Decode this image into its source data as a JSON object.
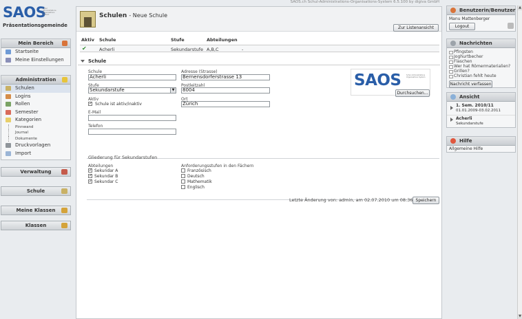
{
  "topbar": {
    "product_line": "SAOS.ch Schul-Administrations-Organisations-System 6.5.100 by digiva GmbH"
  },
  "logo": {
    "text": "SAOS",
    "small": "Schul Administrations Organisations System",
    "subtitle": "Präsentationsgemeinde"
  },
  "left": {
    "mein_bereich": {
      "title": "Mein Bereich",
      "items": [
        {
          "label": "Startseite",
          "icon": "home-icon"
        },
        {
          "label": "Meine Einstellungen",
          "icon": "settings-icon"
        }
      ]
    },
    "administration": {
      "title": "Administration",
      "items": [
        {
          "label": "Schulen",
          "icon": "school-icon"
        },
        {
          "label": "Logins",
          "icon": "users-icon"
        },
        {
          "label": "Rollen",
          "icon": "roles-icon"
        },
        {
          "label": "Semester",
          "icon": "calendar-icon"
        },
        {
          "label": "Kategorien",
          "icon": "folder-icon"
        }
      ],
      "subitems": [
        "Pinnwand",
        "Journal",
        "Dokumente"
      ],
      "items2": [
        {
          "label": "Druckvorlagen",
          "icon": "print-icon"
        },
        {
          "label": "Import",
          "icon": "import-icon"
        }
      ]
    },
    "collapsed": [
      "Verwaltung",
      "Schule",
      "Meine Klassen",
      "Klassen"
    ]
  },
  "main": {
    "title": "Schulen",
    "subtitle": "- Neue Schule",
    "list_button": "Zur Listenansicht",
    "columns": [
      "Aktiv",
      "Schule",
      "Stufe",
      "Abteilungen"
    ],
    "row": {
      "schule": "Acherli",
      "stufe": "Sekundarstufe",
      "abteilungen": "A,B,C",
      "extra": "-"
    },
    "section": "Schule",
    "form": {
      "schule_label": "Schule",
      "schule_value": "Acherli",
      "adresse_label": "Adresse (Strasse)",
      "adresse_value": "Bernensdorferstrasse 13",
      "stufe_label": "Stufe",
      "stufe_value": "Sekundarstufe",
      "plz_label": "Postleitzahl",
      "plz_value": "8004",
      "aktiv_label": "Aktiv",
      "aktiv_cb": "Schule ist aktiv/inaktiv",
      "ort_label": "Ort",
      "ort_value": "Zürich",
      "email_label": "E-Mail",
      "email_value": "",
      "telefon_label": "Telefon",
      "telefon_value": "",
      "browse_button": "Durchsuchen..."
    },
    "gliederung": {
      "title": "Gliederung für Sekundarstufen",
      "abt_label": "Abteilungen",
      "abteilungen": [
        "Sekundar A",
        "Sekundar B",
        "Sekundar C"
      ],
      "anf_label": "Anforderungsstufen in den Fächern",
      "faecher": [
        "Französisch",
        "Deutsch",
        "Mathematik",
        "Englisch"
      ]
    },
    "last_change": "Letzte Änderung von: admin, am 02.07.2010 um 08:36",
    "save_button": "Speichern"
  },
  "right": {
    "user": {
      "title": "Benutzerin/Benutzer",
      "name": "Manu Mattenberger",
      "logout": "Logout"
    },
    "news": {
      "title": "Nachrichten",
      "items": [
        "Pfingsten",
        "Joghurtbecher",
        "Flaschen",
        "Wer hat Römermaterialien?",
        "Grillen?",
        "Christian fehlt heute"
      ],
      "button": "Nachricht verfassen"
    },
    "ansicht": {
      "title": "Ansicht",
      "sem": "1. Sem. 2010/11",
      "sem_dates": "01.01.2009-03.02.2011",
      "school": "Acherli",
      "school_sub": "Sekundarstufe"
    },
    "hilfe": {
      "title": "Hilfe",
      "item": "Allgemeine Hilfe"
    }
  }
}
